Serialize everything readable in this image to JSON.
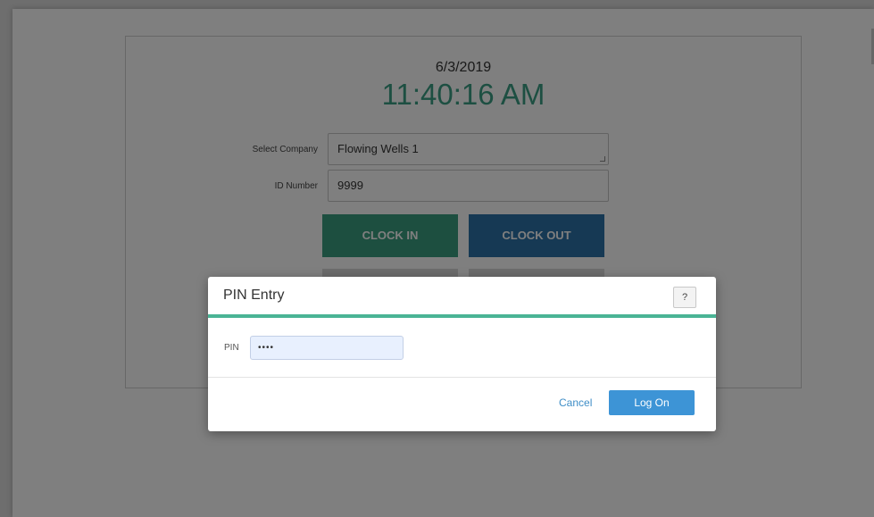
{
  "clock": {
    "date": "6/3/2019",
    "time": "11:40:16 AM"
  },
  "form": {
    "company_label": "Select Company",
    "company_value": "Flowing Wells  1",
    "id_label": "ID Number",
    "id_value": "9999"
  },
  "actions": {
    "clock_in": "CLOCK IN",
    "clock_out": "CLOCK OUT"
  },
  "modal": {
    "title": "PIN Entry",
    "help": "?",
    "pin_label": "PIN",
    "pin_value": "••••",
    "cancel": "Cancel",
    "log_on": "Log On"
  },
  "colors": {
    "accent_green": "#3a9f80",
    "accent_blue": "#2d73a8",
    "link_blue": "#3f8ec7"
  }
}
